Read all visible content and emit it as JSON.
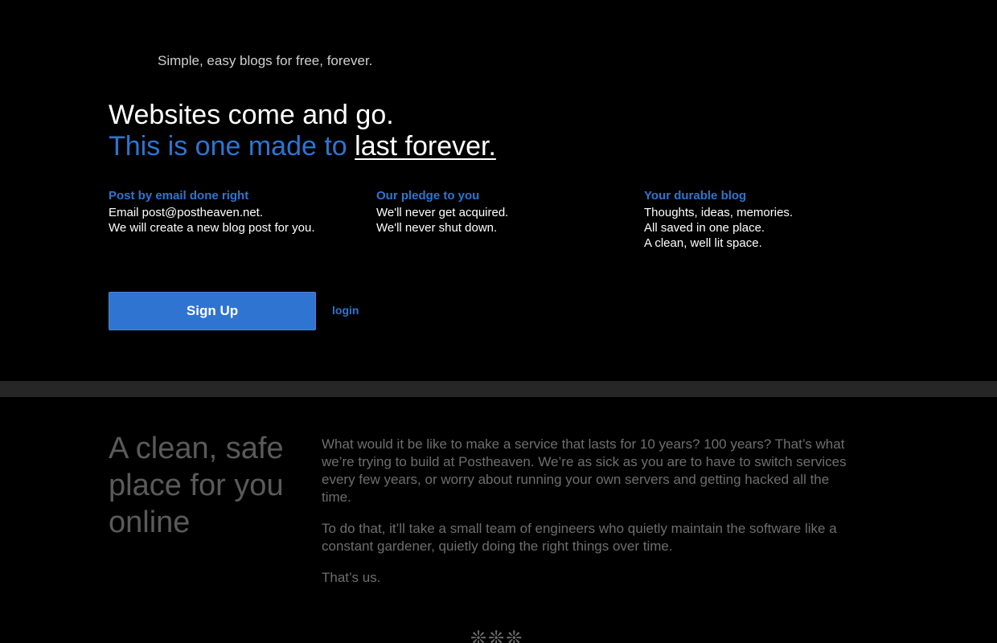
{
  "header": {
    "tagline": "Simple, easy blogs for free, forever."
  },
  "hero": {
    "line1": "Websites come and go.",
    "line2_prefix": "This is one made to ",
    "line2_link": "last forever."
  },
  "features": [
    {
      "title": "Post by email done right",
      "lines": [
        "Email post@postheaven.net.",
        "We will create a new blog post for you."
      ]
    },
    {
      "title": "Our pledge to you",
      "lines": [
        "We'll never get acquired.",
        "We'll never shut down."
      ]
    },
    {
      "title": "Your durable blog",
      "lines": [
        "Thoughts, ideas, memories.",
        "All saved in one place.",
        "A clean, well lit space."
      ]
    }
  ],
  "actions": {
    "signup_label": "Sign Up",
    "login_label": "login"
  },
  "about": {
    "heading": "A clean, safe place for you online",
    "paragraphs": [
      "What would it be like to make a service that lasts for 10 years? 100 years? That’s what we’re trying to build at Postheaven. We’re as sick as you are to have to switch services every few years, or worry about running your own servers and getting hacked all the time.",
      "To do that, it’ll take a small team of engineers who quietly maintain the software like a constant gardener, quietly doing the right things over time.",
      "That’s us."
    ]
  },
  "footer": {
    "ornament": "❊❊❊"
  },
  "colors": {
    "accent": "#2f74d0",
    "background": "#000000",
    "band": "#262626"
  }
}
